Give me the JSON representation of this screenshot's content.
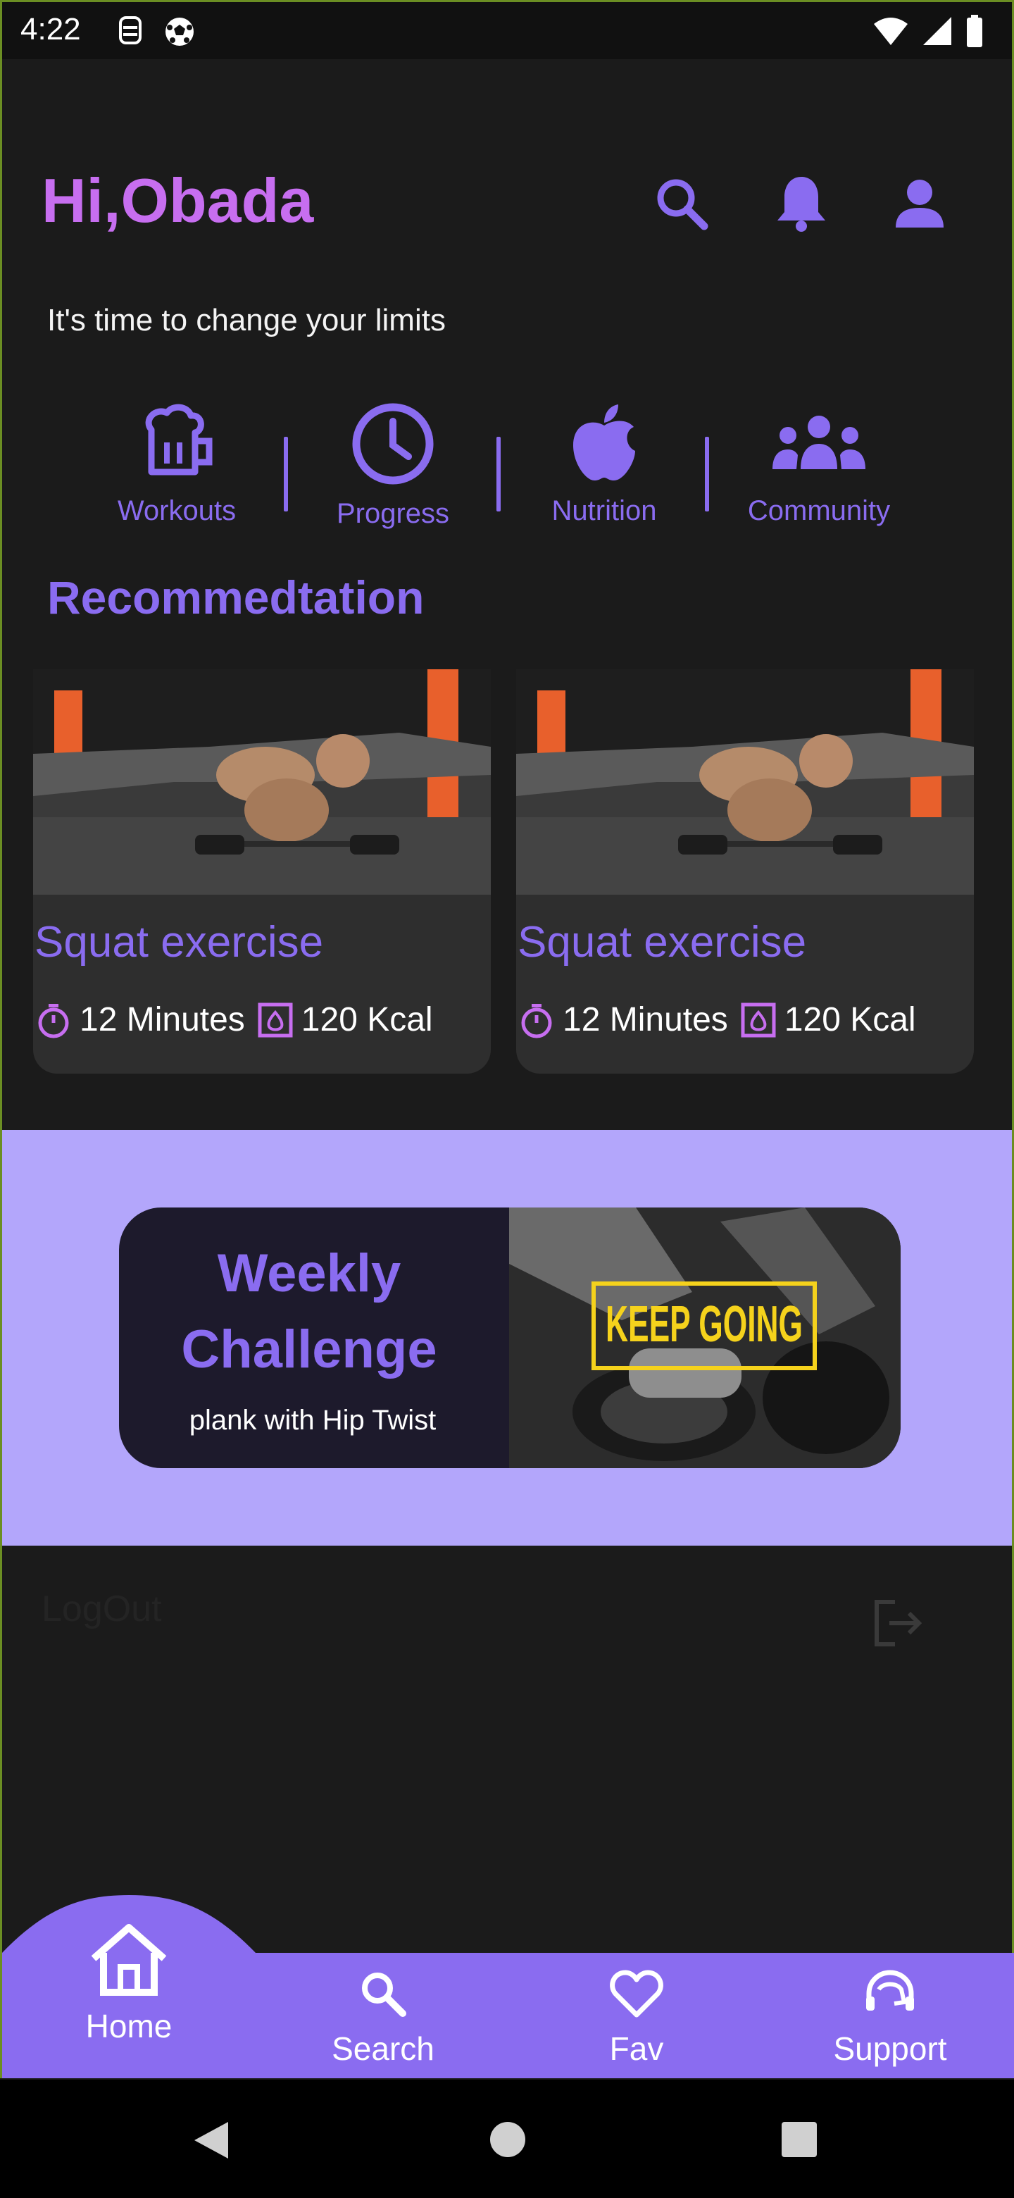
{
  "status_bar": {
    "time": "4:22"
  },
  "header": {
    "greeting": "Hi,Obada",
    "tagline": "It's time to change your limits"
  },
  "categories": [
    {
      "label": "Workouts",
      "icon": "beer-mug-icon"
    },
    {
      "label": "Progress",
      "icon": "clock-icon"
    },
    {
      "label": "Nutrition",
      "icon": "apple-icon"
    },
    {
      "label": "Community",
      "icon": "group-icon"
    }
  ],
  "recommendation": {
    "title": "Recommedtation",
    "cards": [
      {
        "title": "Squat exercise",
        "duration": "12 Minutes",
        "calories": "120 Kcal"
      },
      {
        "title": "Squat exercise",
        "duration": "12 Minutes",
        "calories": "120 Kcal"
      }
    ]
  },
  "challenge": {
    "title_line1": "Weekly",
    "title_line2": "Challenge",
    "subtitle": "plank with Hip Twist",
    "image_text": "KEEP GOING"
  },
  "logout": {
    "label": "LogOut"
  },
  "bottom_nav": [
    {
      "label": "Home",
      "icon": "home-icon"
    },
    {
      "label": "Search",
      "icon": "search-icon"
    },
    {
      "label": "Fav",
      "icon": "heart-icon"
    },
    {
      "label": "Support",
      "icon": "headset-icon"
    }
  ],
  "colors": {
    "accent": "#8a6cf0",
    "greeting": "#c76ef0",
    "band": "#b3a6fb",
    "nav": "#8a6cf0"
  }
}
